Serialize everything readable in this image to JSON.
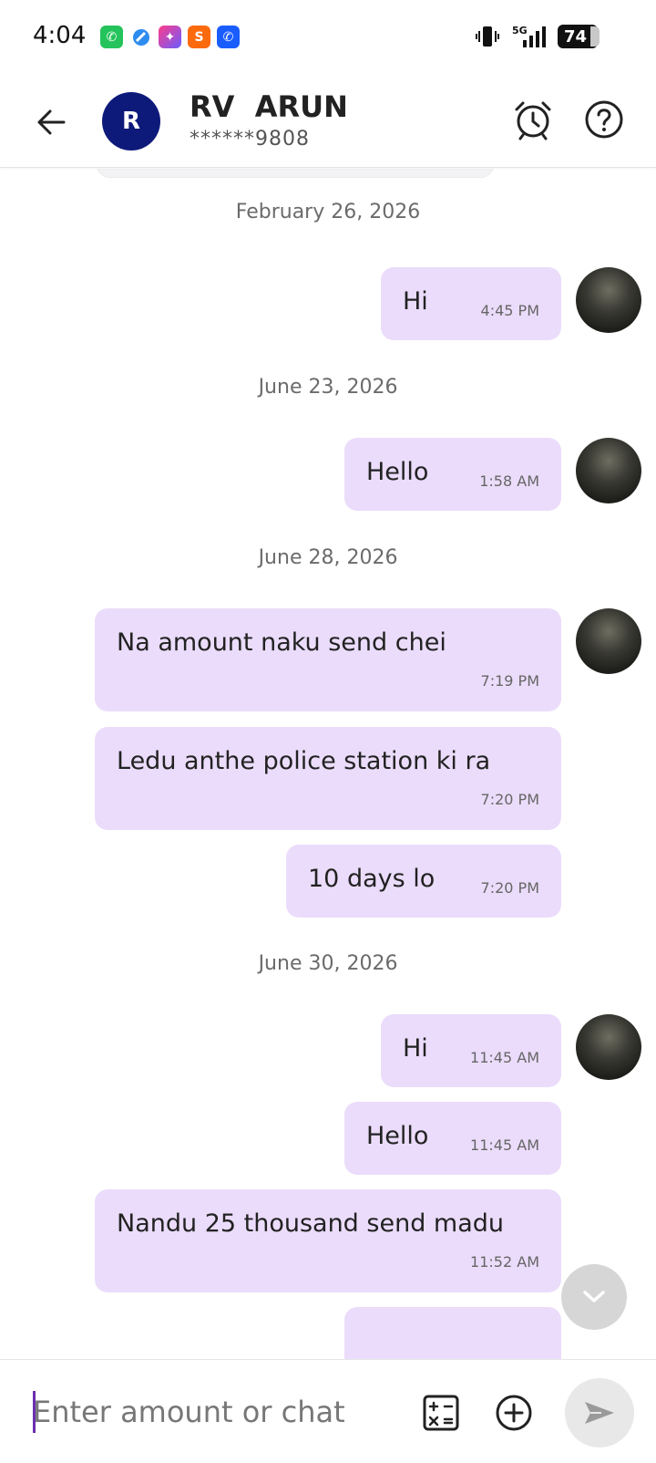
{
  "status_bar": {
    "time": "4:04",
    "battery": "74",
    "network": "5G",
    "notification_icons": [
      "whatsapp-icon",
      "browser-icon",
      "app-star-icon",
      "swiggy-icon",
      "phone-app-icon"
    ]
  },
  "header": {
    "avatar_initial": "R",
    "name": "RV  ARUN",
    "phone": "******9808",
    "avatar_color": "#0d1a7a"
  },
  "colors": {
    "bubble": "#ebdcfb",
    "accent": "#6a2fb0"
  },
  "messages": [
    {
      "date": "February 26, 2026"
    },
    {
      "text": "Hi",
      "time": "4:45 PM"
    },
    {
      "date": "June 23, 2026"
    },
    {
      "text": "Hello",
      "time": "1:58 AM"
    },
    {
      "date": "June 28, 2026"
    },
    {
      "text": "Na amount naku send chei",
      "time": "7:19 PM"
    },
    {
      "text": "Ledu anthe police station ki ra",
      "time": "7:20 PM"
    },
    {
      "text": "10 days lo",
      "time": "7:20 PM"
    },
    {
      "date": "June 30, 2026"
    },
    {
      "text": "Hi",
      "time": "11:45 AM"
    },
    {
      "text": "Hello",
      "time": "11:45 AM"
    },
    {
      "text": "Nandu 25 thousand send madu",
      "time": "11:52 AM"
    }
  ],
  "input": {
    "placeholder": "Enter amount or chat"
  }
}
